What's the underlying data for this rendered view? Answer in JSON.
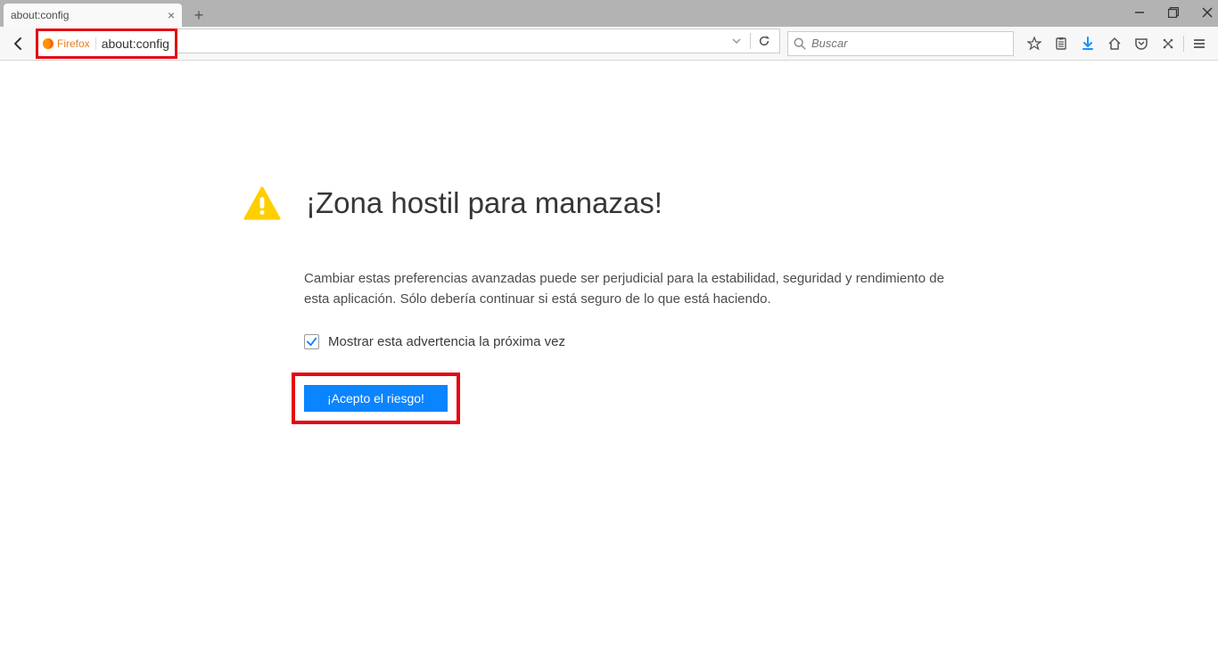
{
  "tab": {
    "title": "about:config"
  },
  "identity": {
    "brand": "Firefox",
    "url": "about:config"
  },
  "search": {
    "placeholder": "Buscar"
  },
  "warning": {
    "title": "¡Zona hostil para manazas!",
    "body": "Cambiar estas preferencias avanzadas puede ser perjudicial para la estabilidad, seguridad y rendimiento de esta aplicación. Sólo debería continuar si está seguro de lo que está haciendo.",
    "checkbox_label": "Mostrar esta advertencia la próxima vez",
    "accept_label": "¡Acepto el riesgo!"
  }
}
